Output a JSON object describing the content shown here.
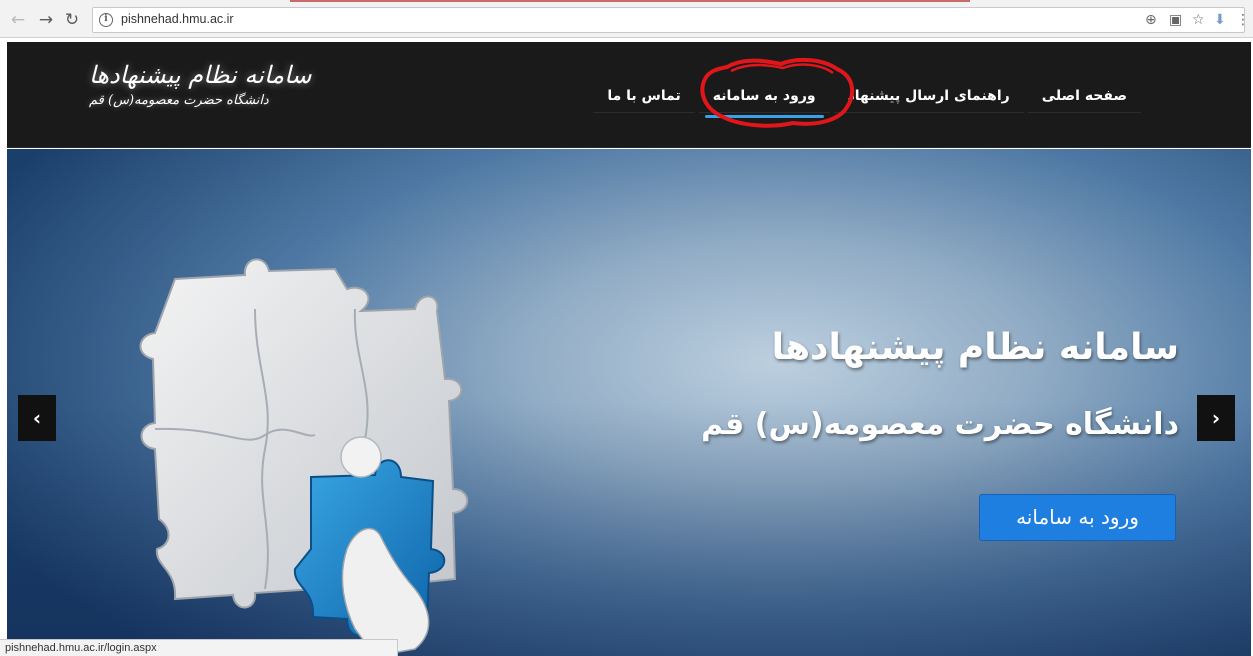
{
  "browser": {
    "url": "pishnehad.hmu.ac.ir",
    "status_url": "pishnehad.hmu.ac.ir/login.aspx",
    "icons": [
      "back-arrow-icon",
      "forward-arrow-icon",
      "reload-icon",
      "info-icon",
      "zoom-icon",
      "translate-icon",
      "star-icon",
      "download-icon",
      "menu-icon"
    ]
  },
  "header": {
    "logo_line1": "سامانه نظام پیشنهادها",
    "logo_line2": "دانشگاه حضرت معصومه(س) قم",
    "menu": {
      "home": "صفحه اصلی",
      "guide": "راهنمای ارسال پیشنهاد",
      "login": "ورود به سامانه",
      "contact": "تماس با ما"
    },
    "active_item": "login",
    "accent_color": "#3aa0e8"
  },
  "hero": {
    "title": "سامانه نظام پیشنهادها",
    "subtitle": "دانشگاه حضرت معصومه(س) قم",
    "cta_label": "ورود به سامانه",
    "prev_label": "‹",
    "next_label": "›",
    "button_color": "#1f7fe0"
  },
  "annotation": {
    "color": "#e0161b"
  }
}
